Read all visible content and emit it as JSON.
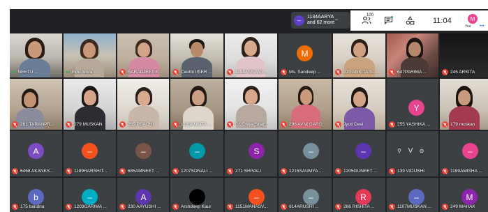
{
  "header": {
    "more_participants_avatar_letter": "–",
    "more_participants_line1": "1134AARYA _",
    "more_participants_line2": "and 62 more",
    "participants_count": "100",
    "clock": "11:04",
    "self_avatar_letter": "M",
    "self_label": "You"
  },
  "colors": {
    "meeting_bg": "#202124",
    "tile_bg": "#3c4043",
    "mic_muted": "#ea4335",
    "accent": "#1a73e8"
  },
  "tiles": [
    {
      "name": "NEETU ...",
      "speaking": true
    },
    {
      "name": "Indu Arora",
      "speaking": true
    },
    {
      "name": "SARABJEET K...",
      "muted": true
    },
    {
      "name": "Ceutbi IISER ...",
      "muted": true
    },
    {
      "name": "1198ANNANY...",
      "muted": true
    },
    {
      "name": "Ms. Sandeep ...",
      "muted": true,
      "avatar_letter": "M"
    },
    {
      "name": "270 ANKITA S...",
      "muted": true
    },
    {
      "name": "647PARIMA ...",
      "muted": true
    },
    {
      "name": "245 ARKITA",
      "muted": true
    },
    {
      "name": "261 TARANPR...",
      "muted": true
    },
    {
      "name": "279 MUSKAN",
      "muted": true
    },
    {
      "name": "265 PRACHI",
      "muted": true
    },
    {
      "name": "1128ANKITA ...",
      "muted": true
    },
    {
      "name": "Dr. Divya Shar...",
      "muted": true
    },
    {
      "name": "296 AVNI GARG",
      "muted": true
    },
    {
      "name": "Jyoti Devi",
      "muted": true
    },
    {
      "name": "255 YASHIKA ...",
      "muted": true,
      "avatar_letter": "Y"
    },
    {
      "name": "179 muskan",
      "muted": true
    },
    {
      "name": "6468 AKANKS...",
      "muted": true,
      "avatar_letter": "A"
    },
    {
      "name": "1189HARSHIT...",
      "muted": true,
      "avatar_letter": "–"
    },
    {
      "name": "685AMNEET ...",
      "muted": true,
      "avatar_letter": "–"
    },
    {
      "name": "1207SONALI ...",
      "muted": true,
      "avatar_letter": "–"
    },
    {
      "name": "271 SHIVALI",
      "muted": true,
      "avatar_letter": "S"
    },
    {
      "name": "1215SAUMYA ...",
      "muted": true,
      "avatar_letter": "–"
    },
    {
      "name": "1205GUNEET ...",
      "muted": true,
      "avatar_letter": "–"
    },
    {
      "name": "139 VIDUSHI",
      "muted": true,
      "avatar_letter": "V"
    },
    {
      "name": "1199AMISHA ...",
      "muted": true,
      "avatar_letter": "–"
    },
    {
      "name": "175 bandna",
      "muted": true,
      "avatar_letter": "b"
    },
    {
      "name": "1203GARIMA ...",
      "muted": true,
      "avatar_letter": "–"
    },
    {
      "name": "230 AAYUSHI ...",
      "muted": true,
      "avatar_letter": "A"
    },
    {
      "name": "Arshdeep Kaur",
      "muted": true,
      "avatar_letter": ""
    },
    {
      "name": "1151MANASV...",
      "muted": true,
      "avatar_letter": "–"
    },
    {
      "name": "614ARUSHI ...",
      "muted": true,
      "avatar_letter": "–"
    },
    {
      "name": "266 RISHITA ...",
      "muted": true,
      "avatar_letter": "R"
    },
    {
      "name": "1107MUSKAN ...",
      "muted": true,
      "avatar_letter": "–"
    },
    {
      "name": "249 MAHAK",
      "muted": true,
      "avatar_letter": "M"
    }
  ]
}
